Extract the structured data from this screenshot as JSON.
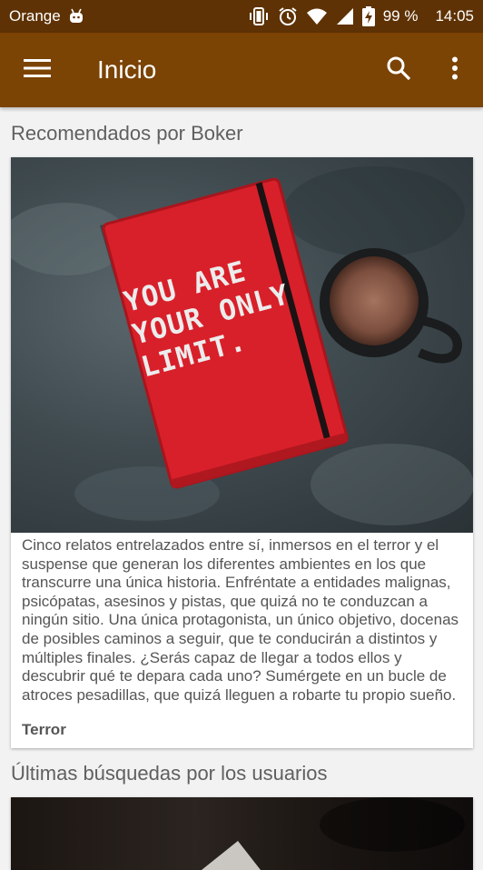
{
  "status_bar": {
    "carrier": "Orange",
    "battery": "99 %",
    "time": "14:05"
  },
  "app_bar": {
    "title": "Inicio",
    "icons": [
      "menu-icon",
      "search-icon",
      "more-vert-icon"
    ]
  },
  "recommended": {
    "heading": "Recomendados por Boker",
    "book": {
      "cover_text": [
        "YOU ARE",
        "YOUR ONLY",
        "LIMIT."
      ],
      "description": "Cinco relatos entrelazados entre sí, inmersos en el terror y el suspense que generan los diferentes ambientes en los que transcurre una única historia. Enfréntate a entidades malignas, psicópatas, asesinos y pistas, que quizá no te conduzcan a ningún sitio. Una única protagonista, un único objetivo, docenas de posibles caminos a seguir, que te conducirán a distintos y múltiples finales. ¿Serás capaz de llegar a todos ellos y descubrir qué te depara cada uno? Sumérgete en un bucle de atroces pesadillas, que quizá lleguen a robarte tu propio sueño.",
      "genre": "Terror"
    }
  },
  "recent_searches": {
    "heading": "Últimas búsquedas por los usuarios"
  },
  "colors": {
    "status_bar": "#5e3204",
    "app_bar": "#7b4304",
    "background": "#f2f2f2"
  }
}
